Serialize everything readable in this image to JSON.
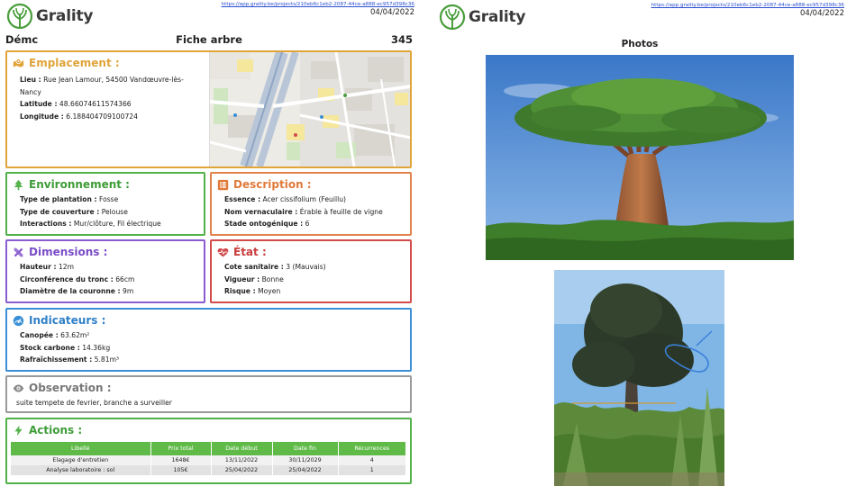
{
  "brand": {
    "name": "Grality",
    "color": "#4a9e3c"
  },
  "left_page": {
    "header": {
      "url": "https://app.grality.be/projects/210eb6c1eb2-2087-44ce-a888-ec957d398c36",
      "date": "04/04/2022"
    },
    "title_bar": {
      "city": "Démc",
      "title": "Fiche arbre",
      "number": "345"
    },
    "emplacement": {
      "title": "Emplacement :",
      "icon": "map-pin-icon",
      "rows": [
        {
          "label": "Lieu :",
          "value": "Rue Jean Lamour, 54500 Vandœuvre-lès-Nancy"
        },
        {
          "label": "Latitude :",
          "value": "48.66074611574366"
        },
        {
          "label": "Longitude :",
          "value": "6.188404709100724"
        }
      ]
    },
    "environnement": {
      "title": "Environnement :",
      "icon": "tree-icon",
      "rows": [
        {
          "label": "Type de plantation :",
          "value": "Fosse"
        },
        {
          "label": "Type de couverture :",
          "value": "Pelouse"
        },
        {
          "label": "Interactions :",
          "value": "Mur/clôture, Fil électrique"
        }
      ]
    },
    "description": {
      "title": "Description :",
      "icon": "list-icon",
      "rows": [
        {
          "label": "Essence :",
          "value": "Acer cissifolium (Feuillu)"
        },
        {
          "label": "Nom vernaculaire :",
          "value": "Érable à feuille de vigne"
        },
        {
          "label": "Stade ontogénique :",
          "value": "6"
        }
      ]
    },
    "dimensions": {
      "title": "Dimensions :",
      "icon": "ruler-pencil-icon",
      "rows": [
        {
          "label": "Hauteur :",
          "value": "12m"
        },
        {
          "label": "Circonférence du tronc :",
          "value": "66cm"
        },
        {
          "label": "Diamètre de la couronne :",
          "value": "9m"
        }
      ]
    },
    "etat": {
      "title": "État :",
      "icon": "heart-pulse-icon",
      "rows": [
        {
          "label": "Cote sanitaire :",
          "value": "3 (Mauvais)"
        },
        {
          "label": "Vigueur :",
          "value": "Bonne"
        },
        {
          "label": "Risque :",
          "value": "Moyen"
        }
      ]
    },
    "indicateurs": {
      "title": "Indicateurs :",
      "icon": "gauge-icon",
      "rows": [
        {
          "label": "Canopée :",
          "value": "63.62m²"
        },
        {
          "label": "Stock carbone :",
          "value": "14.36kg"
        },
        {
          "label": "Rafraîchissement :",
          "value": "5.81m³"
        }
      ]
    },
    "observation": {
      "title": "Observation :",
      "icon": "eye-icon",
      "text": "suite tempete de fevrier, branche a surveiller"
    },
    "actions": {
      "title": "Actions :",
      "icon": "bolt-icon",
      "columns": [
        "Libellé",
        "Prix total",
        "Date début",
        "Date fin",
        "Récurrences"
      ],
      "rows": [
        [
          "Elagage d'entretien",
          "1648€",
          "13/11/2022",
          "30/11/2029",
          "4"
        ],
        [
          "Analyse laboratoire : sol",
          "105€",
          "25/04/2022",
          "25/04/2022",
          "1"
        ]
      ]
    }
  },
  "right_page": {
    "header": {
      "url": "https://app.grality.be/projects/210eb6c1eb2-2087-44ce-a888-ec957d398c36",
      "date": "04/04/2022"
    },
    "photos_title": "Photos"
  }
}
